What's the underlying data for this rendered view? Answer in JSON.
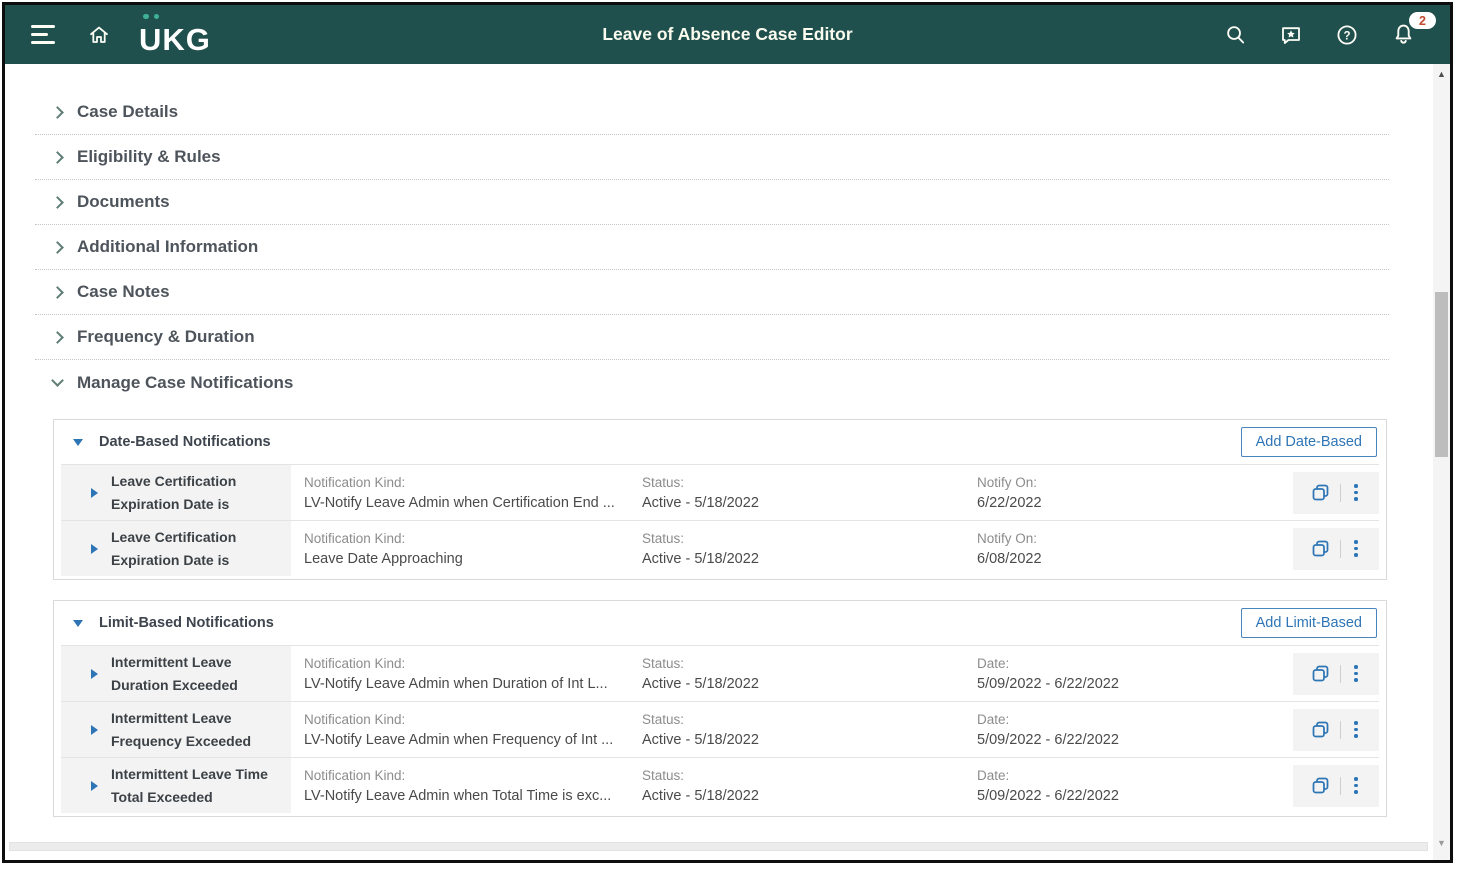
{
  "header": {
    "title": "Leave of Absence Case Editor",
    "logo_text": "UKG",
    "notification_badge": "2"
  },
  "sections": [
    {
      "label": "Case Details",
      "state": "collapsed"
    },
    {
      "label": "Eligibility & Rules",
      "state": "collapsed"
    },
    {
      "label": "Documents",
      "state": "collapsed"
    },
    {
      "label": "Additional Information",
      "state": "collapsed"
    },
    {
      "label": "Case Notes",
      "state": "collapsed"
    },
    {
      "label": "Frequency & Duration",
      "state": "collapsed"
    },
    {
      "label": "Manage Case Notifications",
      "state": "expanded"
    }
  ],
  "date_based": {
    "title": "Date-Based Notifications",
    "add_button_label": "Add Date-Based",
    "rows": [
      {
        "title_line1": "Leave Certification",
        "title_line2": "Expiration Date is",
        "kind_label": "Notification Kind:",
        "kind_value": "LV-Notify Leave Admin when Certification End ...",
        "status_label": "Status:",
        "status_value": "Active - 5/18/2022",
        "date_label": "Notify On:",
        "date_value": "6/22/2022"
      },
      {
        "title_line1": "Leave Certification",
        "title_line2": "Expiration Date is",
        "kind_label": "Notification Kind:",
        "kind_value": "Leave Date Approaching",
        "status_label": "Status:",
        "status_value": "Active - 5/18/2022",
        "date_label": "Notify On:",
        "date_value": "6/08/2022"
      }
    ]
  },
  "limit_based": {
    "title": "Limit-Based Notifications",
    "add_button_label": "Add Limit-Based",
    "rows": [
      {
        "title_line1": "Intermittent Leave",
        "title_line2": "Duration Exceeded",
        "kind_label": "Notification Kind:",
        "kind_value": "LV-Notify Leave Admin when Duration of Int L...",
        "status_label": "Status:",
        "status_value": "Active - 5/18/2022",
        "date_label": "Date:",
        "date_value": "5/09/2022 - 6/22/2022"
      },
      {
        "title_line1": "Intermittent Leave",
        "title_line2": "Frequency Exceeded",
        "kind_label": "Notification Kind:",
        "kind_value": "LV-Notify Leave Admin when Frequency of Int ...",
        "status_label": "Status:",
        "status_value": "Active - 5/18/2022",
        "date_label": "Date:",
        "date_value": "5/09/2022 - 6/22/2022"
      },
      {
        "title_line1": "Intermittent Leave Time",
        "title_line2": "Total Exceeded",
        "kind_label": "Notification Kind:",
        "kind_value": "LV-Notify Leave Admin when Total Time is exc...",
        "status_label": "Status:",
        "status_value": "Active - 5/18/2022",
        "date_label": "Date:",
        "date_value": "5/09/2022 - 6/22/2022"
      }
    ]
  },
  "colors": {
    "header_bg": "#1f504d",
    "accent_blue": "#2e75b6",
    "logo_dot_teal": "#3fb195",
    "badge_text": "#c0492f"
  }
}
